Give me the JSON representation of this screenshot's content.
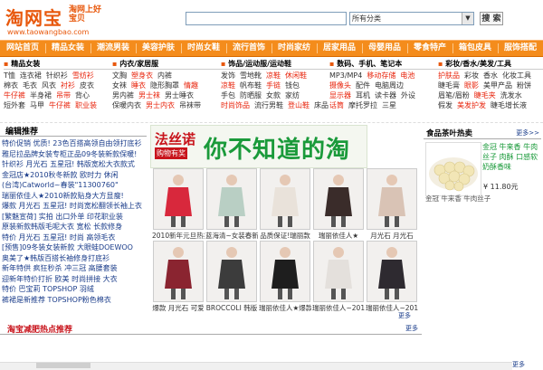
{
  "header": {
    "logo": "淘网宝",
    "slogan": "淘网上好宝贝",
    "url": "www.taowangbao.com",
    "search_placeholder": "",
    "category_selected": "所有分类",
    "search_button": "搜 索"
  },
  "nav": [
    "网站首页",
    "精品女装",
    "潮流男装",
    "美容护肤",
    "时尚女鞋",
    "流行首饰",
    "时尚家纺",
    "居家用品",
    "母婴用品",
    "零食特产",
    "箱包皮具",
    "服饰搭配"
  ],
  "categories": [
    {
      "title": "精品女装",
      "rows": [
        [
          "T恤",
          "连衣裙",
          "针织衫",
          "雪纺衫"
        ],
        [
          "棉衣",
          "毛衣",
          "风衣",
          "衬衫",
          "皮衣"
        ],
        [
          "牛仔裤",
          "半身裙",
          "吊带",
          "背心"
        ],
        [
          "短外套",
          "马甲",
          "牛仔裤",
          "职业装"
        ]
      ],
      "red": [
        "雪纺衫",
        "衬衫",
        "牛仔裤",
        "吊带",
        "职业装"
      ]
    },
    {
      "title": "内衣/家居服",
      "rows": [
        [
          "文胸",
          "塑身衣",
          "内裤"
        ],
        [
          "女袜",
          "睡衣",
          "隐形胸罩",
          "情趣"
        ],
        [
          "男内裤",
          "男士袜",
          "男士睡衣"
        ],
        [
          "保暖内衣",
          "男士内衣",
          "吊袜带"
        ]
      ],
      "red": [
        "塑身衣",
        "睡衣",
        "情趣",
        "男士内衣",
        "男士袜"
      ]
    },
    {
      "title": "饰品/运动服/运动鞋",
      "rows": [
        [
          "发饰",
          "雪地靴",
          "凉鞋",
          "休闲鞋"
        ],
        [
          "凉鞋",
          "帆布鞋",
          "手链",
          "钱包"
        ],
        [
          "手包",
          "防晒服",
          "女款",
          "家纺"
        ],
        [
          "时尚饰品",
          "流行男鞋",
          "登山鞋",
          "床品"
        ]
      ],
      "red": [
        "凉鞋",
        "休闲鞋",
        "手链",
        "时尚饰品",
        "登山鞋"
      ]
    },
    {
      "title": "数码、手机、笔记本",
      "rows": [
        [
          "MP3/MP4",
          "移动存储",
          "电池"
        ],
        [
          "摄像头",
          "配件",
          "电脑周边"
        ],
        [
          "显示器",
          "耳机",
          "读卡器",
          "外设"
        ],
        [
          "话筒",
          "摩托罗拉",
          "三星"
        ]
      ],
      "red": [
        "移动存储",
        "电池",
        "摄像头",
        "显示器",
        "话筒"
      ]
    },
    {
      "title": "彩妆/香水/美发/工具",
      "rows": [
        [
          "护肤品",
          "彩妆",
          "香水",
          "化妆工具"
        ],
        [
          "睫毛膏",
          "眼影",
          "美甲产品",
          "粉饼"
        ],
        [
          "眉笔/眉粉",
          "睫毛夹",
          "洗发水"
        ],
        [
          "假发",
          "美发护发",
          "睫毛增长液"
        ]
      ],
      "red": [
        "护肤品",
        "眼影",
        "睫毛夹",
        "美发护发"
      ]
    }
  ],
  "editor": {
    "title": "编辑推荐",
    "lines": [
      "特价促销 优质! 23色百搭高领自由领打底衫",
      "雅尼拉品牌女装专柜正品09冬装新款保暖!",
      "针织衫 月光石 五星冠! 韩版宽松大衣款式",
      "金冠店★2010秋冬新款 欧时力 休闲",
      "(台湾)Catworld~春装\"11300760\"",
      "瑞丽依佳人★2010新款贴身大方显瘦!",
      "爆款 月光石 五星冠! 时尚宽松翻领长袖上衣",
      "[繁魅宣荷] 实拍 出口外单 印花职业装",
      "原装新款韩版毛呢大衣 宽松 长款修身",
      "特价 月光石 五星冠! 时尚 高领毛衣",
      "[预售]09冬装女装新款 大眼蛙DOEWOO",
      "奥美了★韩版百搭长袖修身打底衫",
      "新年特供 疯狂秒杀 冲三冠 高腰套装",
      "迎新年特价打折 欧美 时尚拼接 大衣",
      "特价 巴宝莉 TOPSHOP 羽绒",
      "裤裙是新推荐 TOPSHOP粉色棉衣"
    ]
  },
  "banner": {
    "brand": "法丝诺",
    "tag": "购物有奖",
    "headline": "你不知道的淘宝"
  },
  "products_row1": [
    {
      "caption": "2010新年元旦热卖",
      "color": "#d8283c"
    },
    {
      "caption": "蓝海清~女装春新款",
      "color": "#b9cfc4"
    },
    {
      "caption": "品质保证!瑞丽款",
      "color": "#e9e2da"
    },
    {
      "caption": "瑞丽依佳人★",
      "color": "#3a2c2a"
    },
    {
      "caption": "月光石 月光石",
      "color": "#d9c3b5"
    }
  ],
  "products_row2": [
    {
      "caption": "爆款 月光石 可爱",
      "color": "#8a2430"
    },
    {
      "caption": "BROCCOLI 韩版",
      "color": "#3c3c3c"
    },
    {
      "caption": "瑞丽依佳人★爆款",
      "color": "#1e1e1e"
    },
    {
      "caption": "瑞丽依佳人~2010",
      "color": "#e4e0dc"
    },
    {
      "caption": "瑞丽依佳人~2010",
      "color": "#2e2a30"
    }
  ],
  "right_box": {
    "title": "食品茶叶热卖",
    "more": "更多>>",
    "desc": "金冠 牛来香 牛肉丝子 肉酥 口感软 奶酥香味",
    "price": "¥ 11.80元",
    "foot": "金冠 牛来香 牛肉丝子",
    "more2": "更多"
  },
  "bottom": {
    "title": "淘宝减肥热点推荐",
    "more": "更多"
  },
  "misc": {
    "more_left": "更多"
  }
}
